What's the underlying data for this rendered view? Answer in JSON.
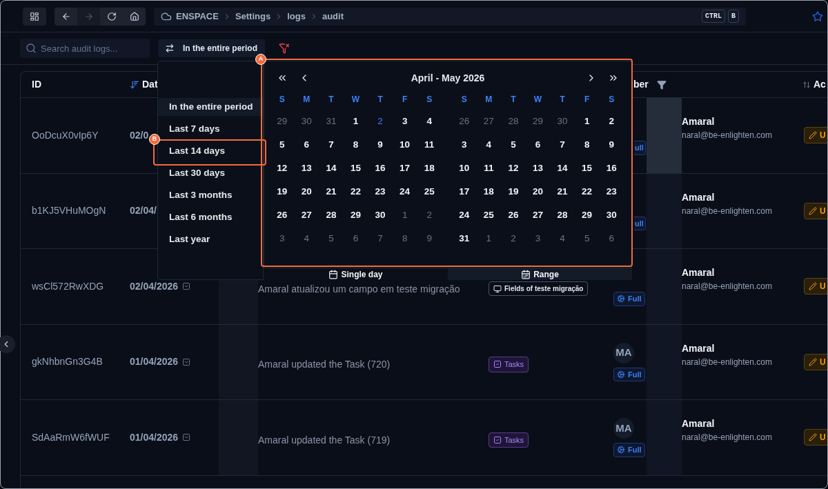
{
  "topbar": {
    "nav": [
      {
        "kind": "back",
        "disabled": false
      },
      {
        "kind": "forward",
        "disabled": true
      },
      {
        "kind": "reload",
        "disabled": false
      },
      {
        "kind": "home",
        "disabled": false
      }
    ],
    "breadcrumb": [
      "ENSPACE",
      "Settings",
      "logs",
      "audit"
    ],
    "shortcut": [
      "CTRL",
      "B"
    ]
  },
  "filter_bar": {
    "search": {
      "placeholder": "Search audit logs..."
    },
    "period_button": "In the entire period"
  },
  "table": {
    "columns": [
      {
        "label": "ID"
      },
      {
        "label": "Dat"
      },
      {
        "label": "ber"
      },
      {
        "label": "Ac"
      }
    ],
    "rows": [
      {
        "id": "OoDcuX0vIp6Y",
        "date": "02/0",
        "member": {
          "name": "Amaral",
          "email": "naral@be-enlighten.com",
          "access": "ull",
          "partial": true
        },
        "action": "U"
      },
      {
        "id": "b1KJ5VHuMOgN",
        "date": "02/04/",
        "member": {
          "name": "Amaral",
          "email": "naral@be-enlighten.com",
          "access": "ull",
          "partial": true
        },
        "action": "U"
      },
      {
        "id": "wsCl572RwXDG",
        "date": "02/04/2026",
        "description": "Amaral atualizou um campo em teste migração",
        "module": {
          "label": "Fields of teste migração",
          "kind": "fields"
        },
        "member": {
          "name": "Amaral",
          "email": "naral@be-enlighten.com",
          "access": "Full",
          "partial": false
        },
        "action": "U"
      },
      {
        "id": "gkNhbnGn3G4B",
        "date": "01/04/2026",
        "description": "Amaral updated the Task (720)",
        "module": {
          "label": "Tasks",
          "kind": "tasks"
        },
        "member": {
          "avatar": "MA",
          "name": "Amaral",
          "email": "naral@be-enlighten.com",
          "access": "Full",
          "partial": false
        },
        "action": "U"
      },
      {
        "id": "SdAaRmW6fWUF",
        "date": "01/04/2026",
        "description": "Amaral updated the Task (719)",
        "module": {
          "label": "Tasks",
          "kind": "tasks"
        },
        "member": {
          "avatar": "MA",
          "name": "Amaral",
          "email": "naral@be-enlighten.com",
          "access": "Full",
          "partial": false
        },
        "action": "U"
      }
    ]
  },
  "period_menu": {
    "items": [
      {
        "label": "In the entire period",
        "selected": true
      },
      {
        "label": "Last 7 days",
        "selected": false
      },
      {
        "label": "Last 14 days",
        "selected": false
      },
      {
        "label": "Last 30 days",
        "selected": false
      },
      {
        "label": "Last 3 months",
        "selected": false
      },
      {
        "label": "Last 6 months",
        "selected": false
      },
      {
        "label": "Last year",
        "selected": false
      }
    ]
  },
  "calendar": {
    "title": "April - May 2026",
    "months": [
      {
        "weekdays": [
          "S",
          "M",
          "T",
          "W",
          "T",
          "F",
          "S"
        ],
        "weeks": [
          [
            {
              "day": "29",
              "kind": "outside"
            },
            {
              "day": "30",
              "kind": "outside"
            },
            {
              "day": "31",
              "kind": "outside"
            },
            {
              "day": "1",
              "kind": "current"
            },
            {
              "day": "2",
              "kind": "today"
            },
            {
              "day": "3",
              "kind": "current"
            },
            {
              "day": "4",
              "kind": "current"
            }
          ],
          [
            {
              "day": "5",
              "kind": "current"
            },
            {
              "day": "6",
              "kind": "current"
            },
            {
              "day": "7",
              "kind": "current"
            },
            {
              "day": "8",
              "kind": "current"
            },
            {
              "day": "9",
              "kind": "current"
            },
            {
              "day": "10",
              "kind": "current"
            },
            {
              "day": "11",
              "kind": "current"
            }
          ],
          [
            {
              "day": "12",
              "kind": "current"
            },
            {
              "day": "13",
              "kind": "current"
            },
            {
              "day": "14",
              "kind": "current"
            },
            {
              "day": "15",
              "kind": "current"
            },
            {
              "day": "16",
              "kind": "current"
            },
            {
              "day": "17",
              "kind": "current"
            },
            {
              "day": "18",
              "kind": "current"
            }
          ],
          [
            {
              "day": "19",
              "kind": "current"
            },
            {
              "day": "20",
              "kind": "current"
            },
            {
              "day": "21",
              "kind": "current"
            },
            {
              "day": "22",
              "kind": "current"
            },
            {
              "day": "23",
              "kind": "current"
            },
            {
              "day": "24",
              "kind": "current"
            },
            {
              "day": "25",
              "kind": "current"
            }
          ],
          [
            {
              "day": "26",
              "kind": "current"
            },
            {
              "day": "27",
              "kind": "current"
            },
            {
              "day": "28",
              "kind": "current"
            },
            {
              "day": "29",
              "kind": "current"
            },
            {
              "day": "30",
              "kind": "current"
            },
            {
              "day": "1",
              "kind": "outside"
            },
            {
              "day": "2",
              "kind": "outside"
            }
          ],
          [
            {
              "day": "3",
              "kind": "outside"
            },
            {
              "day": "4",
              "kind": "outside"
            },
            {
              "day": "5",
              "kind": "outside"
            },
            {
              "day": "6",
              "kind": "outside"
            },
            {
              "day": "7",
              "kind": "outside"
            },
            {
              "day": "8",
              "kind": "outside"
            },
            {
              "day": "9",
              "kind": "outside"
            }
          ]
        ]
      },
      {
        "weekdays": [
          "S",
          "M",
          "T",
          "W",
          "T",
          "F",
          "S"
        ],
        "weeks": [
          [
            {
              "day": "26",
              "kind": "outside"
            },
            {
              "day": "27",
              "kind": "outside"
            },
            {
              "day": "28",
              "kind": "outside"
            },
            {
              "day": "29",
              "kind": "outside"
            },
            {
              "day": "30",
              "kind": "outside"
            },
            {
              "day": "1",
              "kind": "current"
            },
            {
              "day": "2",
              "kind": "current"
            }
          ],
          [
            {
              "day": "3",
              "kind": "current"
            },
            {
              "day": "4",
              "kind": "current"
            },
            {
              "day": "5",
              "kind": "current"
            },
            {
              "day": "6",
              "kind": "current"
            },
            {
              "day": "7",
              "kind": "current"
            },
            {
              "day": "8",
              "kind": "current"
            },
            {
              "day": "9",
              "kind": "current"
            }
          ],
          [
            {
              "day": "10",
              "kind": "current"
            },
            {
              "day": "11",
              "kind": "current"
            },
            {
              "day": "12",
              "kind": "current"
            },
            {
              "day": "13",
              "kind": "current"
            },
            {
              "day": "14",
              "kind": "current"
            },
            {
              "day": "15",
              "kind": "current"
            },
            {
              "day": "16",
              "kind": "current"
            }
          ],
          [
            {
              "day": "17",
              "kind": "current"
            },
            {
              "day": "18",
              "kind": "current"
            },
            {
              "day": "19",
              "kind": "current"
            },
            {
              "day": "20",
              "kind": "current"
            },
            {
              "day": "21",
              "kind": "current"
            },
            {
              "day": "22",
              "kind": "current"
            },
            {
              "day": "23",
              "kind": "current"
            }
          ],
          [
            {
              "day": "24",
              "kind": "current"
            },
            {
              "day": "25",
              "kind": "current"
            },
            {
              "day": "26",
              "kind": "current"
            },
            {
              "day": "27",
              "kind": "current"
            },
            {
              "day": "28",
              "kind": "current"
            },
            {
              "day": "29",
              "kind": "current"
            },
            {
              "day": "30",
              "kind": "current"
            }
          ],
          [
            {
              "day": "31",
              "kind": "current"
            },
            {
              "day": "1",
              "kind": "outside"
            },
            {
              "day": "2",
              "kind": "outside"
            },
            {
              "day": "3",
              "kind": "outside"
            },
            {
              "day": "4",
              "kind": "outside"
            },
            {
              "day": "5",
              "kind": "outside"
            },
            {
              "day": "6",
              "kind": "outside"
            }
          ]
        ]
      }
    ]
  },
  "mode_buttons": [
    {
      "label": "Single day",
      "kind": "single",
      "selected": false
    },
    {
      "label": "Range",
      "kind": "range",
      "selected": true
    }
  ],
  "annotations": [
    {
      "label": "A"
    },
    {
      "label": "B"
    }
  ]
}
